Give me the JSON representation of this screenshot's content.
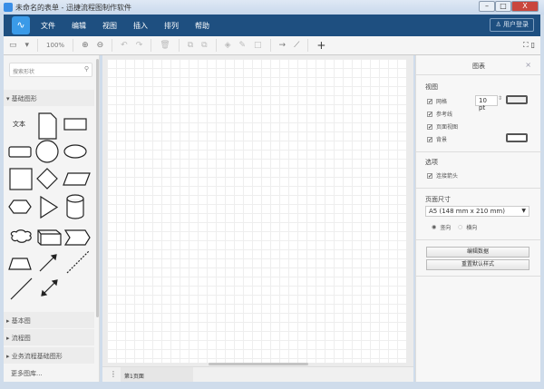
{
  "window": {
    "title": "未命名的表单 - 迅捷流程图制作软件",
    "minimize": "–",
    "maximize": "□",
    "close": "X"
  },
  "menubar": {
    "logo": "∿",
    "items": [
      "文件",
      "编辑",
      "视图",
      "插入",
      "排列",
      "帮助"
    ],
    "login": "用户登录"
  },
  "toolbar": {
    "zoom": "100%",
    "zoom_in": "⊕",
    "zoom_out": "⊖",
    "undo": "↶",
    "redo": "↷",
    "delete": "🗑",
    "to_front": "⧉",
    "to_back": "⧉",
    "fill": "◈",
    "line_color": "✎",
    "shadow": "□",
    "connection": "→",
    "waypoints": "⟋",
    "insert": "+",
    "fullscreen": "⛶",
    "format": "▯",
    "view": "▭"
  },
  "sidebar": {
    "search_placeholder": "搜索形状",
    "sections": [
      "基础图形",
      "基本图",
      "流程图",
      "业务流程基础图形"
    ],
    "text_shape": "文本",
    "more": "更多图库..."
  },
  "bottom": {
    "menu": "⋮",
    "page_tab": "第1页面"
  },
  "panel": {
    "title": "图表",
    "close": "×",
    "view_header": "视图",
    "grid": "网格",
    "grid_size": "10 pt",
    "guides": "参考线",
    "page_view": "页面视图",
    "background": "背景",
    "options_header": "选项",
    "connection_arrows": "连接箭头",
    "paper_header": "页面尺寸",
    "paper_size": "A5 (148 mm x 210 mm)",
    "portrait": "竖向",
    "landscape": "横向",
    "orientation": "portrait",
    "edit_data": "编辑数据",
    "reset_style": "重置默认样式"
  }
}
